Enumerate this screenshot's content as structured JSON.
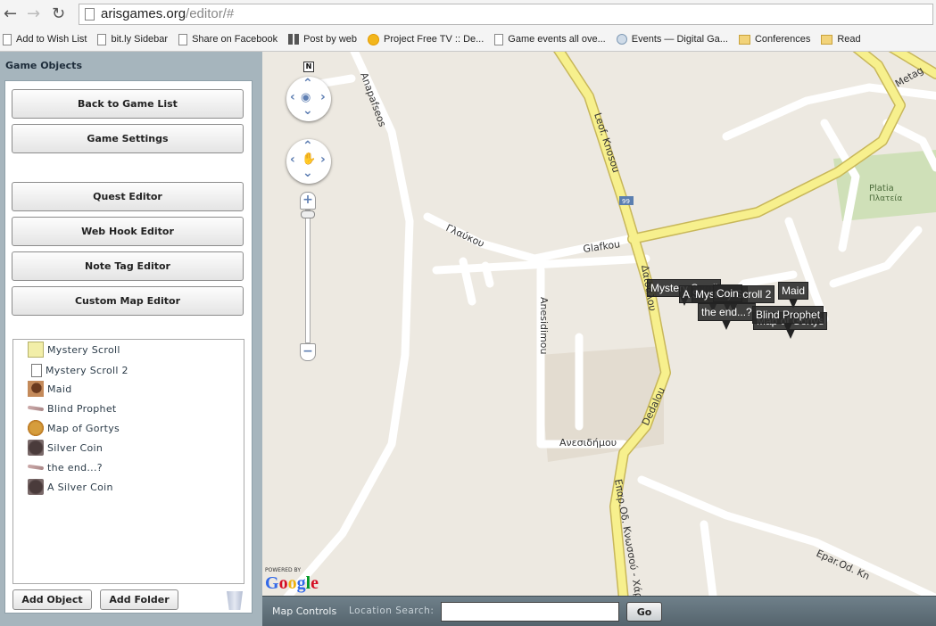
{
  "browser": {
    "url_host": "arisgames.org",
    "url_path": "/editor/#",
    "bookmarks": [
      {
        "label": "Add to Wish List",
        "icon": "page"
      },
      {
        "label": "bit.ly Sidebar",
        "icon": "page"
      },
      {
        "label": "Share on Facebook",
        "icon": "page"
      },
      {
        "label": "Post by web",
        "icon": "grid"
      },
      {
        "label": "Project Free TV :: De...",
        "icon": "circle"
      },
      {
        "label": "Game events all ove...",
        "icon": "page"
      },
      {
        "label": "Events — Digital Ga...",
        "icon": "disc"
      },
      {
        "label": "Conferences",
        "icon": "folder"
      },
      {
        "label": "Read",
        "icon": "folder"
      }
    ]
  },
  "sidebar": {
    "title": "Game Objects",
    "buttons": {
      "back": "Back to Game List",
      "settings": "Game Settings",
      "quest": "Quest Editor",
      "webhook": "Web Hook Editor",
      "notetag": "Note Tag Editor",
      "custommap": "Custom Map Editor"
    },
    "objects": [
      {
        "label": "Mystery Scroll",
        "icon": "scroll"
      },
      {
        "label": "Mystery Scroll 2",
        "icon": "page"
      },
      {
        "label": "Maid",
        "icon": "maid"
      },
      {
        "label": "Blind Prophet",
        "icon": "stick"
      },
      {
        "label": "Map of Gortys",
        "icon": "map"
      },
      {
        "label": "Silver Coin",
        "icon": "coin"
      },
      {
        "label": "the end...?",
        "icon": "stick"
      },
      {
        "label": "A Silver Coin",
        "icon": "coin"
      }
    ],
    "add_object": "Add Object",
    "add_folder": "Add Folder"
  },
  "map": {
    "north": "N",
    "road_labels": {
      "anapafseos": "Anapafseos",
      "knosou": "Leof. Knosou",
      "glafkou_gr": "Γλαύκου",
      "glafkou": "Glafkou",
      "dedalou_gr": "Δαιδάλου",
      "anesidimou": "Anesidimou",
      "anesidimou_gr": "Ανεσιδήμου",
      "dedalou": "Dedalou",
      "epar_gr": "Επαρ.Οδ. Κνωσσού - Χάρακας",
      "epar": "Epar.Od. Kn",
      "metag": "Metag",
      "platia": "Platia",
      "platia_gr": "Πλατεία",
      "route": "99"
    },
    "markers": [
      "Mystery Scroll",
      "A Silver Coin",
      "Mystery Scroll 2",
      "Coin",
      "the end...?",
      "Maid",
      "Map of Gortys",
      "Blind Prophet"
    ],
    "powered_by": "POWERED BY",
    "logo": "Google"
  },
  "bottom_bar": {
    "map_controls": "Map Controls",
    "location_search_label": "Location Search:",
    "location_search_value": "",
    "go": "Go"
  }
}
